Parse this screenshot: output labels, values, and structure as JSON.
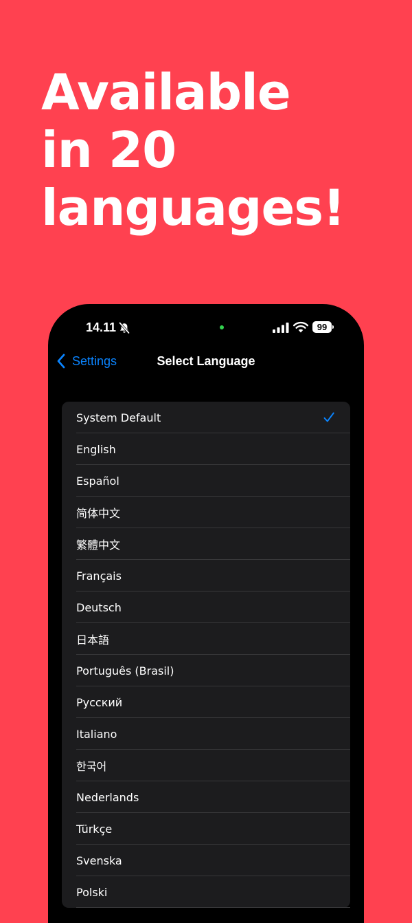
{
  "headline": [
    "Available",
    "in 20",
    "languages!"
  ],
  "status_bar": {
    "time": "14.11",
    "battery": "99",
    "icons": [
      "bell-slash-icon",
      "cellular-signal-icon",
      "wifi-icon",
      "battery-icon"
    ]
  },
  "nav": {
    "back_label": "Settings",
    "title": "Select Language"
  },
  "languages": [
    {
      "label": "System Default",
      "selected": true
    },
    {
      "label": "English"
    },
    {
      "label": "Español"
    },
    {
      "label": "简体中文"
    },
    {
      "label": "繁體中文"
    },
    {
      "label": "Français"
    },
    {
      "label": "Deutsch"
    },
    {
      "label": "日本語"
    },
    {
      "label": "Português (Brasil)"
    },
    {
      "label": "Русский"
    },
    {
      "label": "Italiano"
    },
    {
      "label": "한국어"
    },
    {
      "label": "Nederlands"
    },
    {
      "label": "Türkçe"
    },
    {
      "label": "Svenska"
    },
    {
      "label": "Polski"
    }
  ],
  "colors": {
    "background": "#FF4150",
    "accent": "#0A84FF",
    "cell": "#1C1C1E",
    "separator": "#38383A"
  }
}
